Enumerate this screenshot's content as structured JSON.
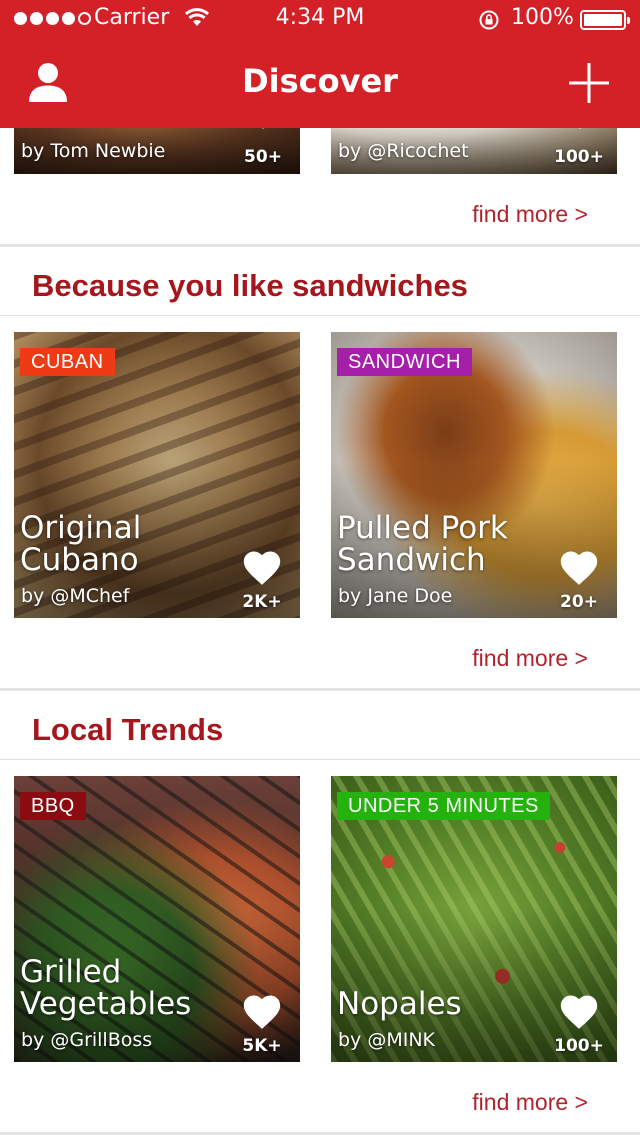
{
  "status_bar": {
    "signal_dots_filled": 4,
    "signal_dots_total": 5,
    "carrier": "Carrier",
    "time": "4:34 PM",
    "battery": "100%"
  },
  "nav": {
    "title": "Discover",
    "left_icon": "profile-icon",
    "right_icon": "plus-icon"
  },
  "colors": {
    "brand_red": "#d42027",
    "section_title": "#a5161d",
    "link": "#b1232c",
    "tag_cuban": "#ef3b15",
    "tag_sandwich": "#a51fa9",
    "tag_bbq": "#8a0c10",
    "tag_under5": "#25b20f"
  },
  "top_row": {
    "cards": [
      {
        "author": "by Tom Newbie",
        "likes": "50+"
      },
      {
        "author": "by @Ricochet",
        "likes": "100+"
      }
    ],
    "find_more": "find more >"
  },
  "sections": [
    {
      "title": "Because you like sandwiches",
      "cards": [
        {
          "tag": "CUBAN",
          "title": "Original Cubano",
          "author": "by @MChef",
          "likes": "2K+"
        },
        {
          "tag": "SANDWICH",
          "title": "Pulled Pork Sandwich",
          "author": "by Jane Doe",
          "likes": "20+"
        }
      ],
      "find_more": "find more >"
    },
    {
      "title": "Local Trends",
      "cards": [
        {
          "tag": "BBQ",
          "title": "Grilled Vegetables",
          "author": "by @GrillBoss",
          "likes": "5K+"
        },
        {
          "tag": "UNDER 5 MINUTES",
          "title": "Nopales",
          "author": "by @MINK",
          "likes": "100+"
        }
      ],
      "find_more": "find more >"
    }
  ]
}
